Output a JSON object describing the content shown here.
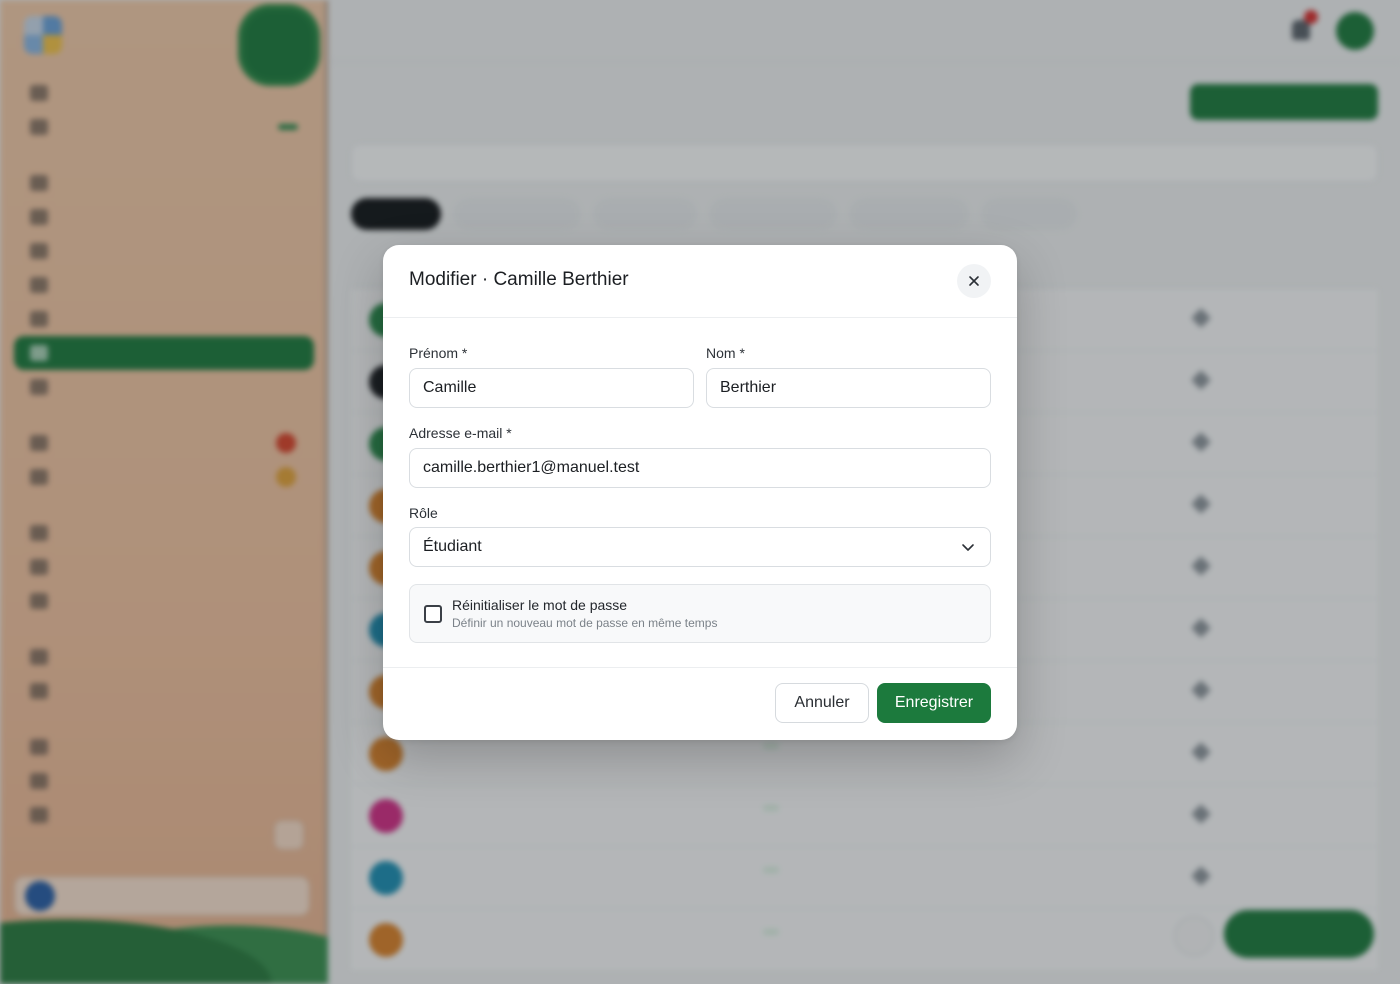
{
  "modal": {
    "title": "Modifier · Camille Berthier",
    "close_icon": "close-icon",
    "first_name": {
      "label": "Prénom *",
      "value": "Camille"
    },
    "last_name": {
      "label": "Nom *",
      "value": "Berthier"
    },
    "email": {
      "label": "Adresse e-mail *",
      "value": "camille.berthier1@manuel.test"
    },
    "role": {
      "label": "Rôle",
      "selected": "Étudiant",
      "icon": "chevron-down-icon"
    },
    "reset_password": {
      "checked": false,
      "title": "Réinitialiser le mot de passe",
      "subtitle": "Définir un nouveau mot de passe en même temps"
    },
    "cancel_label": "Annuler",
    "save_label": "Enregistrer"
  },
  "colors": {
    "accent": "#1c7a3d",
    "overlay": "rgba(28,32,36,0.30)",
    "sidebar_bg": "#f0c4a2"
  }
}
